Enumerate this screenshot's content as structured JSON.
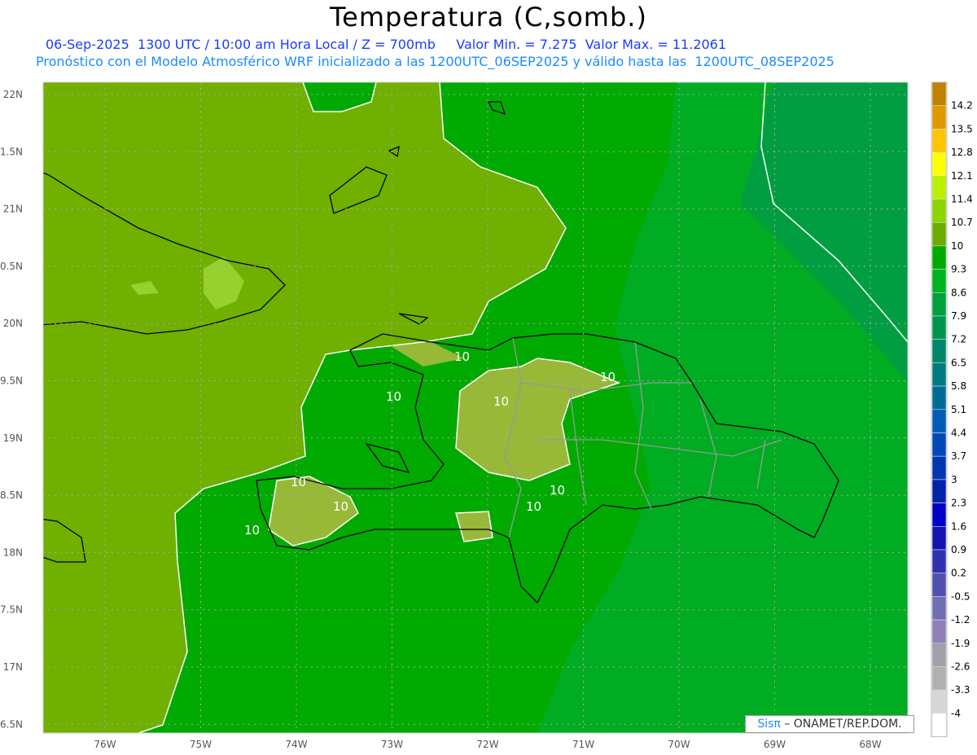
{
  "header": {
    "title": "Temperatura (C,somb.)",
    "subtitle1": "06-Sep-2025  1300 UTC / 10:00 am Hora Local / Z = 700mb     Valor Min. = 7.275  Valor Max. = 11.2061",
    "subtitle2": "Pronóstico con el Modelo Atmosférico WRF inicializado a las 1200UTC_06SEP2025 y válido hasta las  1200UTC_08SEP2025"
  },
  "axes": {
    "lon_labels": [
      "76W",
      "75W",
      "74W",
      "73W",
      "72W",
      "71W",
      "70W",
      "69W",
      "68W"
    ],
    "lat_labels": [
      "22N",
      "1.5N",
      "21N",
      "0.5N",
      "20N",
      "9.5N",
      "19N",
      "8.5N",
      "18N",
      "7.5N",
      "17N",
      "6.5N"
    ]
  },
  "contour_labels": [
    "10",
    "10",
    "10",
    "10",
    "10",
    "10",
    "10",
    "10",
    "10"
  ],
  "colorbar": {
    "labels": [
      "14.2",
      "13.5",
      "12.8",
      "12.1",
      "11.4",
      "10.7",
      "10",
      "9.3",
      "8.6",
      "7.9",
      "7.2",
      "6.5",
      "5.8",
      "5.1",
      "4.4",
      "3.7",
      "3",
      "2.3",
      "1.6",
      "0.9",
      "0.2",
      "-0.5",
      "-1.2",
      "-1.9",
      "-2.6",
      "-3.3",
      "-4"
    ],
    "colors": [
      "#c08000",
      "#e09a00",
      "#ffc400",
      "#ffff00",
      "#b8f000",
      "#8cd400",
      "#6aac00",
      "#00aa00",
      "#00b41e",
      "#00a03c",
      "#009650",
      "#00876a",
      "#007c80",
      "#006c96",
      "#005cb4",
      "#004ab8",
      "#0036b0",
      "#0022a6",
      "#0000c8",
      "#1414b0",
      "#3030b0",
      "#5050b0",
      "#7070b0",
      "#9080b8",
      "#a0a0a8",
      "#b0b0b0",
      "#d6d6d6",
      "#ffffff"
    ]
  },
  "map_colors": {
    "olive": "#6fb000",
    "green": "#00aa00",
    "green2": "#00ac22",
    "green3": "#009e40",
    "island_high": "#98b838"
  },
  "credit": {
    "brand": "Sisπ",
    "text": " – ONAMET/REP.DOM."
  }
}
